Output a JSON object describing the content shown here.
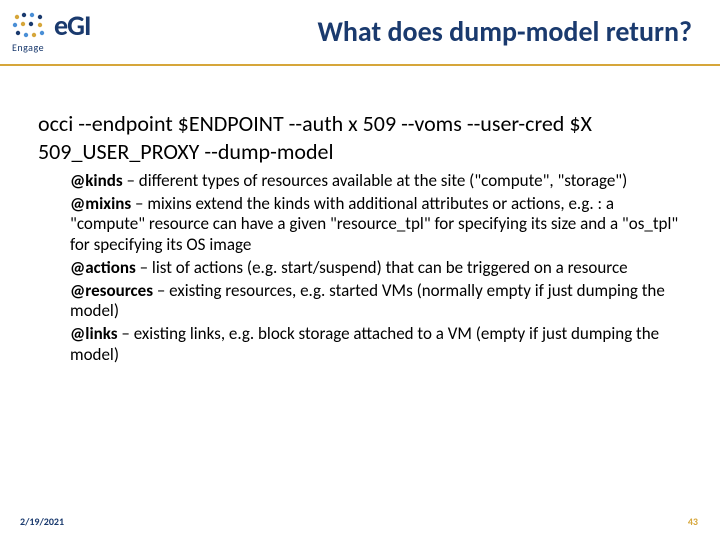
{
  "logo": {
    "text": "eGI",
    "sub": "Engage"
  },
  "title": "What does dump-model return?",
  "command": "occi --endpoint $ENDPOINT --auth x 509 --voms --user-cred $X 509_USER_PROXY --dump-model",
  "defs": [
    {
      "term": "@kinds",
      "desc": " – different types of resources available at the site (\"compute\", \"storage\")"
    },
    {
      "term": "@mixins",
      "desc": " – mixins extend the kinds with additional attributes or actions, e.g. : a \"compute\" resource can have a given \"resource_tpl\" for specifying its size and a \"os_tpl\" for specifying its OS image"
    },
    {
      "term": "@actions",
      "desc": " – list of actions (e.g. start/suspend) that can be triggered on a resource"
    },
    {
      "term": "@resources",
      "desc": "  – existing resources, e.g. started VMs (normally empty if just dumping the model)"
    },
    {
      "term": "@links",
      "desc": " – existing links, e.g. block storage attached to a VM (empty if just dumping the model)"
    }
  ],
  "footer": {
    "date": "2/19/2021",
    "page": "43"
  }
}
